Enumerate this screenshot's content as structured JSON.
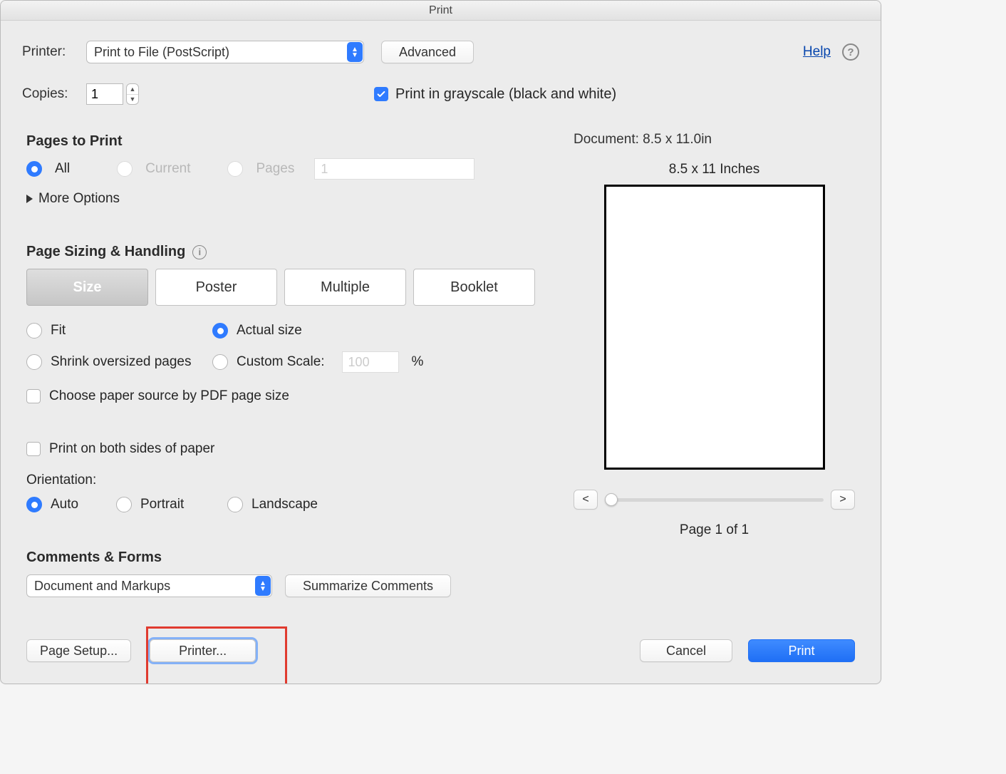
{
  "title": "Print",
  "help_label": "Help",
  "printer": {
    "label": "Printer:",
    "selected": "Print to File (PostScript)",
    "advanced_button": "Advanced"
  },
  "copies": {
    "label": "Copies:",
    "value": "1"
  },
  "grayscale": {
    "checked": true,
    "label": "Print in grayscale (black and white)"
  },
  "pages": {
    "heading": "Pages to Print",
    "all": "All",
    "current": "Current",
    "pages_label": "Pages",
    "pages_value": "1",
    "more_options": "More Options"
  },
  "sizing": {
    "heading": "Page Sizing & Handling",
    "seg": {
      "size": "Size",
      "poster": "Poster",
      "multiple": "Multiple",
      "booklet": "Booklet"
    },
    "fit": "Fit",
    "actual": "Actual size",
    "shrink": "Shrink oversized pages",
    "custom_scale": "Custom Scale:",
    "custom_scale_value": "100",
    "percent": "%",
    "choose_source": "Choose paper source by PDF page size"
  },
  "both_sides": {
    "label": "Print on both sides of paper",
    "orientation_label": "Orientation:",
    "auto": "Auto",
    "portrait": "Portrait",
    "landscape": "Landscape"
  },
  "comments": {
    "heading": "Comments & Forms",
    "selected": "Document and Markups",
    "summarize": "Summarize Comments"
  },
  "preview": {
    "doc_line": "Document: 8.5 x 11.0in",
    "page_label": "8.5 x 11 Inches",
    "prev": "<",
    "next": ">",
    "page_of": "Page 1 of 1"
  },
  "buttons": {
    "page_setup": "Page Setup...",
    "printer": "Printer...",
    "cancel": "Cancel",
    "print": "Print"
  }
}
